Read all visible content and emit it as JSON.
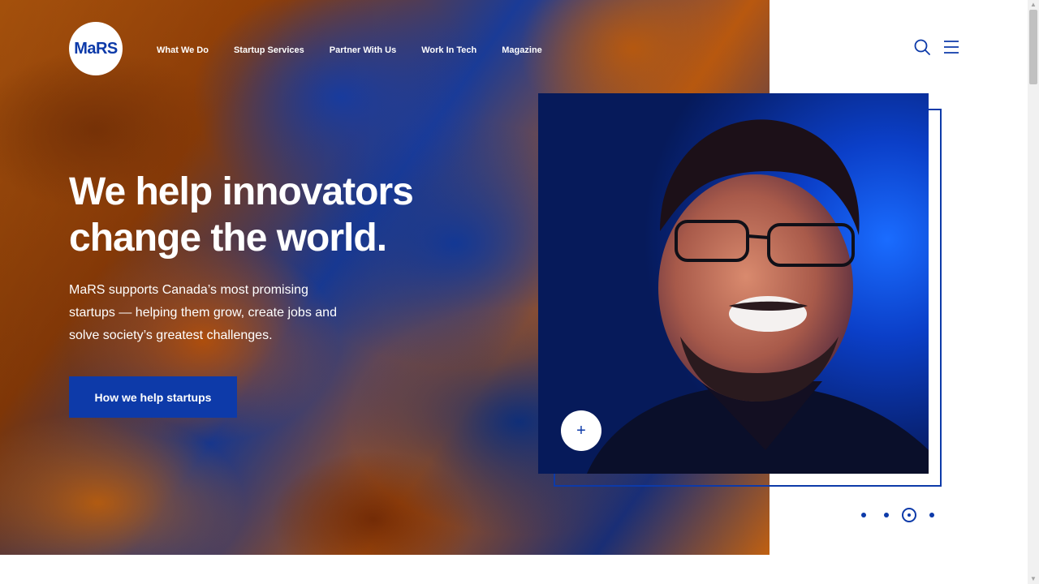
{
  "brand": {
    "logo_text": "MaRS"
  },
  "nav": {
    "items": [
      {
        "label": "What We Do"
      },
      {
        "label": "Startup Services"
      },
      {
        "label": "Partner With Us"
      },
      {
        "label": "Work In Tech"
      },
      {
        "label": "Magazine"
      }
    ]
  },
  "utility": {
    "search_icon": "search-icon",
    "menu_icon": "hamburger-menu-icon"
  },
  "hero": {
    "headline": "We help innovators change the world.",
    "subtext": "MaRS supports Canada’s most promising startups — helping them grow, create jobs and solve society’s greatest challenges.",
    "cta_label": "How we help startups"
  },
  "feature": {
    "photo_icon": "portrait-photo",
    "expand_label": "+"
  },
  "carousel": {
    "total": 4,
    "active_index": 2
  },
  "colors": {
    "brand_blue": "#0d3aa9",
    "white": "#ffffff"
  }
}
